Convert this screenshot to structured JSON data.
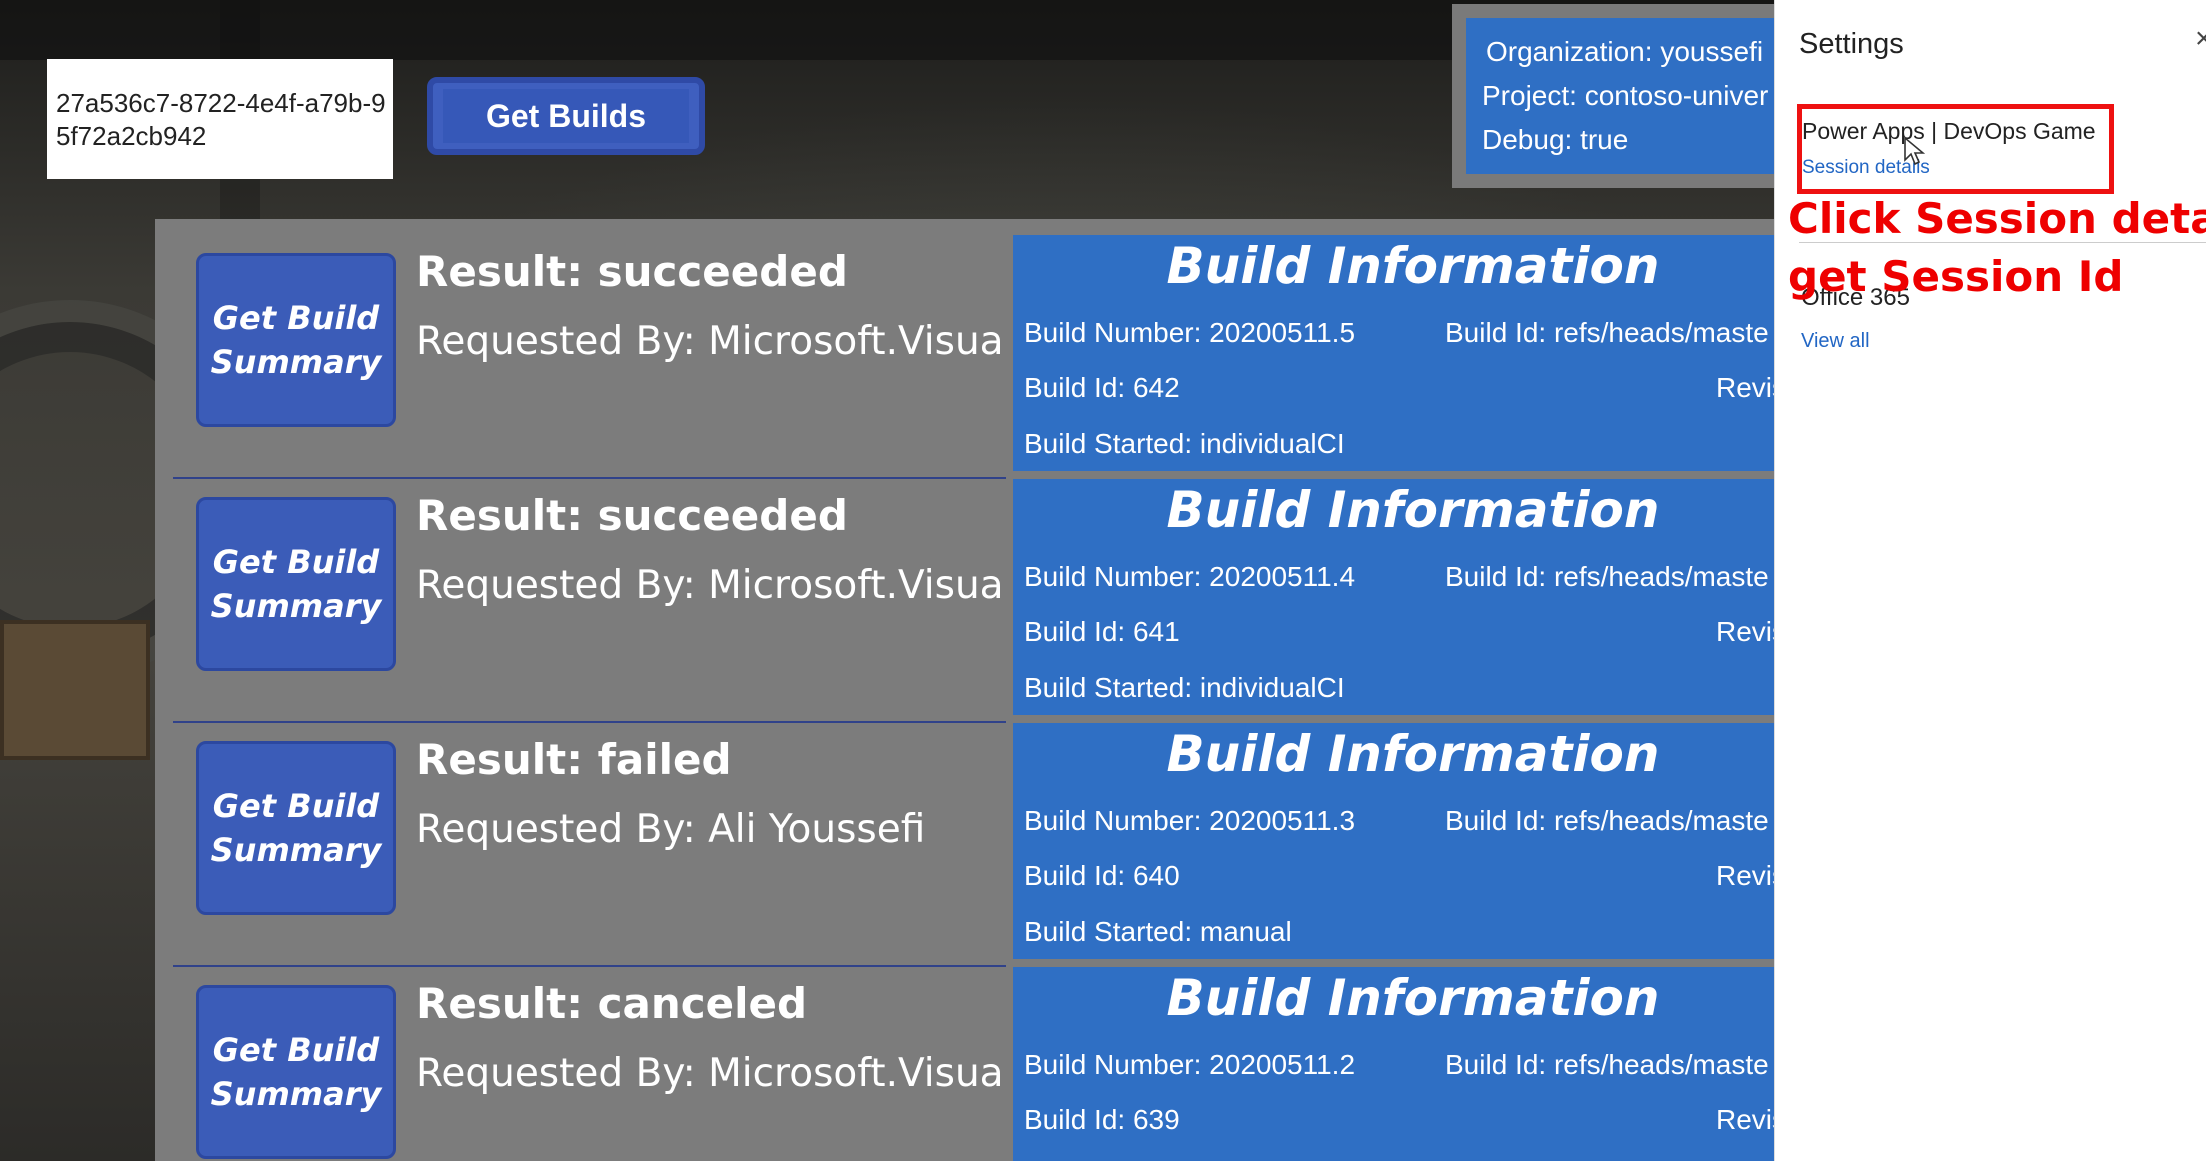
{
  "session": {
    "id_value": "27a536c7-8722-4e4f-a79b-95f72a2cb942"
  },
  "toolbar": {
    "get_builds_label": "Get Builds"
  },
  "org_panel": {
    "organization": "Organization: youssefi",
    "project": "Project: contoso-univer",
    "debug": "Debug: true"
  },
  "builds": [
    {
      "button_line1": "Get Build",
      "button_line2": "Summary",
      "result": "Result: succeeded",
      "requested_by": "Requested By: Microsoft.VisualStu",
      "info_title": "Build Information",
      "build_number": "Build Number: 20200511.5",
      "build_ref": "Build Id: refs/heads/maste",
      "build_id": "Build Id: 642",
      "revision": "Revision Number:",
      "build_started": "Build Started: individualCI"
    },
    {
      "button_line1": "Get Build",
      "button_line2": "Summary",
      "result": "Result: succeeded",
      "requested_by": "Requested By: Microsoft.VisualStu",
      "info_title": "Build Information",
      "build_number": "Build Number: 20200511.4",
      "build_ref": "Build Id: refs/heads/maste",
      "build_id": "Build Id: 641",
      "revision": "Revision Number:",
      "build_started": "Build Started: individualCI"
    },
    {
      "button_line1": "Get Build",
      "button_line2": "Summary",
      "result": "Result: failed",
      "requested_by": "Requested By: Ali Youssefi",
      "info_title": "Build Information",
      "build_number": "Build Number: 20200511.3",
      "build_ref": "Build Id: refs/heads/maste",
      "build_id": "Build Id: 640",
      "revision": "Revision Number:",
      "build_started": "Build Started: manual"
    },
    {
      "button_line1": "Get Build",
      "button_line2": "Summary",
      "result": "Result: canceled",
      "requested_by": "Requested By: Microsoft.VisualStu",
      "info_title": "Build Information",
      "build_number": "Build Number: 20200511.2",
      "build_ref": "Build Id: refs/heads/maste",
      "build_id": "Build Id: 639",
      "revision": "Revision Number:",
      "build_started": ""
    }
  ],
  "settings": {
    "title": "Settings",
    "close_glyph": "×",
    "apps_line": "Power Apps  |  DevOps Game",
    "session_details_link": "Session details",
    "office": "Office 365",
    "view_all_link": "View all"
  },
  "annotation": {
    "line1": "Click Session details",
    "line2": "get Session Id",
    "color": "#ee0000"
  },
  "colors": {
    "panel_blue": "#2f6fc4",
    "button_blue": "#3b5cb8",
    "highlight_red": "#ee1111",
    "link_blue": "#2266c4"
  }
}
